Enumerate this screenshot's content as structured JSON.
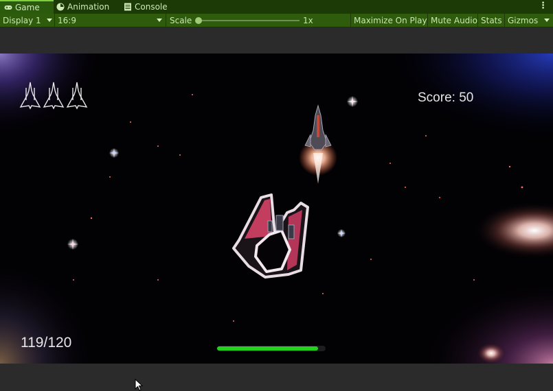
{
  "tabs": [
    {
      "label": "Game",
      "icon": "gamepad-icon",
      "active": true
    },
    {
      "label": "Animation",
      "icon": "clock-icon",
      "active": false
    },
    {
      "label": "Console",
      "icon": "console-icon",
      "active": false
    }
  ],
  "toolbar": {
    "display_label": "Display 1",
    "aspect_label": "16:9",
    "scale_label": "Scale",
    "scale_value": "1x",
    "maximize_label": "Maximize On Play",
    "mute_label": "Mute Audio",
    "stats_label": "Stats",
    "gizmos_label": "Gizmos"
  },
  "game": {
    "score_text": "Score: 50",
    "health_text": "119/120",
    "health_current": 119,
    "health_max": 120,
    "lives": 3,
    "colors": {
      "health_bar": "#22d11e",
      "thruster": "#ffb089",
      "shield_ship": "#d24a6a"
    }
  }
}
